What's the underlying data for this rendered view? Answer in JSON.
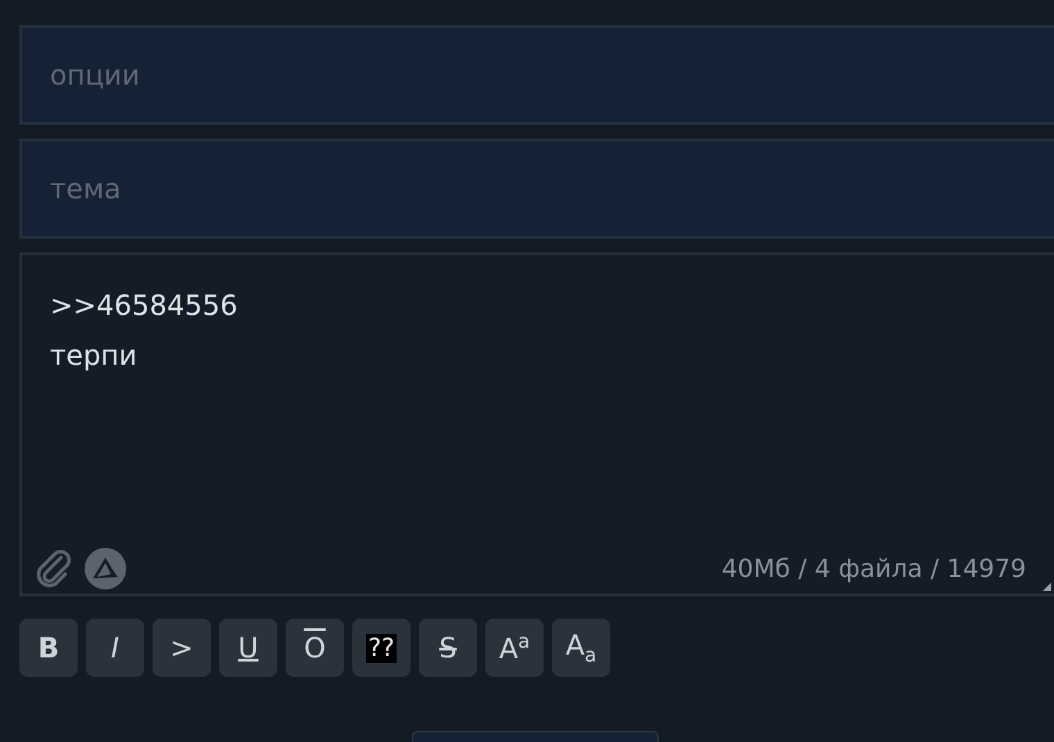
{
  "fields": [
    {
      "placeholder": "опции"
    },
    {
      "placeholder": "тема"
    }
  ],
  "message": {
    "value": ">>46584556\nтерпи",
    "counter": "40Мб / 4 файла / 14979"
  },
  "toolbar": [
    {
      "label": "B",
      "kind": "bold"
    },
    {
      "label": "I",
      "kind": "italic"
    },
    {
      "label": ">",
      "kind": "plain"
    },
    {
      "label": "U",
      "kind": "underline"
    },
    {
      "label": "O",
      "kind": "overline"
    },
    {
      "label": "??",
      "kind": "spoiler"
    },
    {
      "label": "S",
      "kind": "strike"
    },
    {
      "label": "A$^{a}$",
      "kind": "plain"
    },
    {
      "label": "A$_{a}$",
      "kind": "plain"
    }
  ]
}
